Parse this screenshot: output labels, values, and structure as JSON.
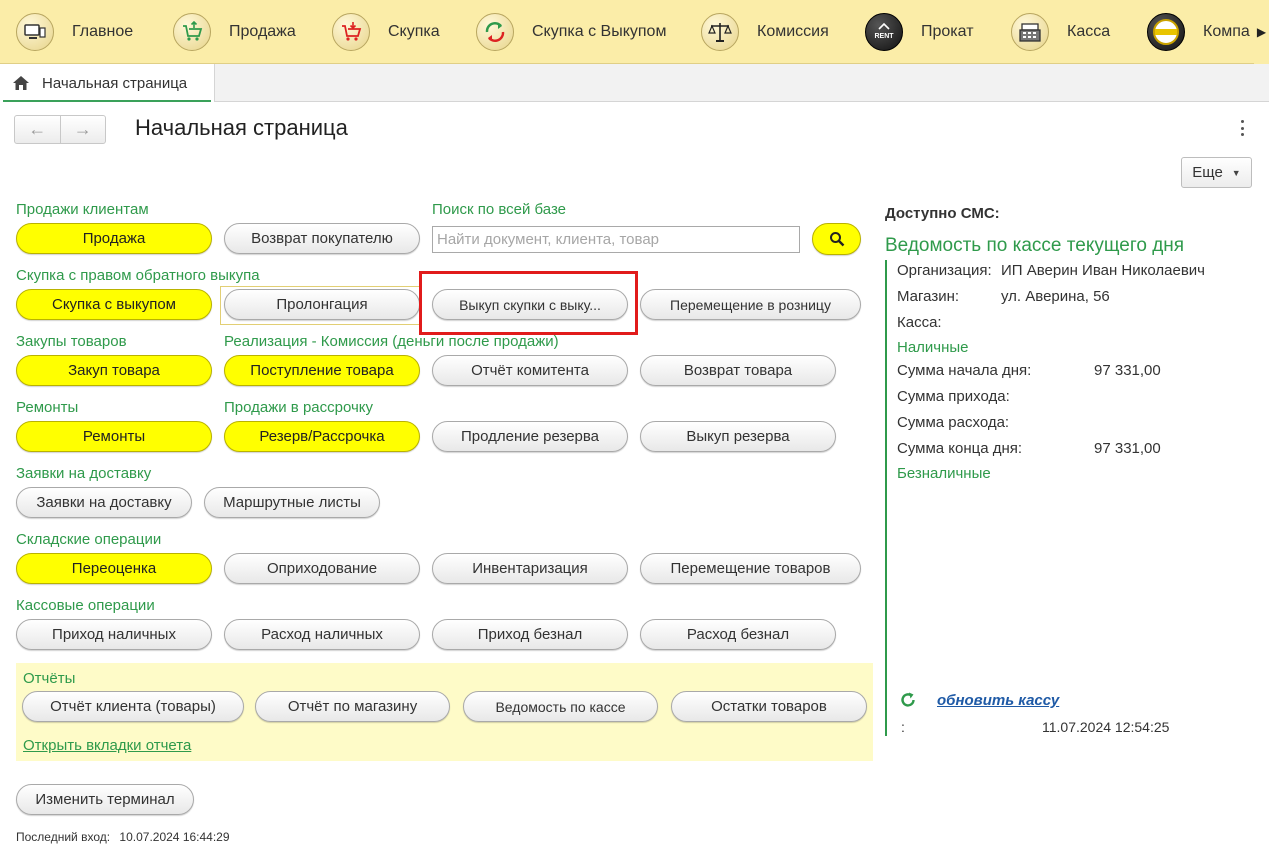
{
  "topnav": {
    "items": [
      {
        "label": "Главное",
        "icon": "monitor-icon"
      },
      {
        "label": "Продажа",
        "icon": "cart-up-icon"
      },
      {
        "label": "Скупка",
        "icon": "cart-down-icon"
      },
      {
        "label": "Скупка с Выкупом",
        "icon": "cycle-arrows-icon"
      },
      {
        "label": "Комиссия",
        "icon": "scales-icon"
      },
      {
        "label": "Прокат",
        "icon": "rent-icon"
      },
      {
        "label": "Касса",
        "icon": "cash-register-icon"
      },
      {
        "label": "Компа",
        "icon": "company-logo-icon"
      }
    ],
    "rent_badge": "RENT",
    "scroll": "▶"
  },
  "tabs": {
    "home_label": "Начальная страница"
  },
  "page": {
    "title": "Начальная страница",
    "more_label": "Еще",
    "back": "←",
    "forward": "→"
  },
  "sections": {
    "sales": "Продажи клиентам",
    "search": "Поиск по всей базе",
    "buyback": "Скупка с правом обратного выкупа",
    "purchases": "Закупы товаров",
    "commission": "Реализация - Комиссия (деньги после продажи)",
    "repairs": "Ремонты",
    "installments": "Продажи в рассрочку",
    "delivery": "Заявки на доставку",
    "warehouse": "Складские операции",
    "cash_ops": "Кассовые операции",
    "reports": "Отчёты"
  },
  "buttons": {
    "sale": "Продажа",
    "customer_return": "Возврат покупателю",
    "buyback": "Скупка с выкупом",
    "prolongation": "Пролонгация",
    "buyback_redeem": "Выкуп скупки с выку...",
    "move_retail": "Перемещение в розницу",
    "purchase": "Закуп товара",
    "goods_receipt": "Поступление товара",
    "consignor_report": "Отчёт комитента",
    "goods_return": "Возврат товара",
    "repairs": "Ремонты",
    "reserve": "Резерв/Рассрочка",
    "reserve_extend": "Продление резерва",
    "reserve_redeem": "Выкуп резерва",
    "delivery_requests": "Заявки на доставку",
    "route_sheets": "Маршрутные листы",
    "revaluation": "Переоценка",
    "posting": "Оприходование",
    "inventory": "Инвентаризация",
    "move_goods": "Перемещение товаров",
    "cash_in": "Приход наличных",
    "cash_out": "Расход наличных",
    "cashless_in": "Приход безнал",
    "cashless_out": "Расход безнал",
    "client_report": "Отчёт клиента (товары)",
    "shop_report": "Отчёт по магазину",
    "cash_statement": "Ведомость по кассе",
    "stock": "Остатки товаров",
    "change_terminal": "Изменить терминал"
  },
  "search": {
    "placeholder": "Найти документ, клиента, товар"
  },
  "links": {
    "open_report_tabs": "Открыть вкладки отчета"
  },
  "footer": {
    "last_login_label": "Последний вход:",
    "last_login_value": "10.07.2024 16:44:29"
  },
  "right": {
    "sms": "Доступно СМС:",
    "title": "Ведомость по кассе текущего дня",
    "org_label": "Организация:",
    "org_value": "ИП Аверин Иван Николаевич",
    "shop_label": "Магазин:",
    "shop_value": "ул. Аверина, 56",
    "cash_label": "Касса:",
    "cash_section": "Наличные",
    "start_label": "Сумма начала дня:",
    "start_value": "97 331,00",
    "income_label": "Сумма прихода:",
    "expense_label": "Сумма расхода:",
    "end_label": "Сумма конца дня:",
    "end_value": "97 331,00",
    "cashless_section": "Безналичные",
    "refresh_label": "обновить кассу",
    "colon": ":",
    "timestamp": "11.07.2024 12:54:25"
  },
  "colors": {
    "topbar": "#fbeda8",
    "accent_green": "#2f9a4b",
    "yellow_button": "#ffff00",
    "reports_panel": "#fefbc8",
    "highlight_red": "#e11b1b",
    "link_blue": "#1f5aa6"
  }
}
